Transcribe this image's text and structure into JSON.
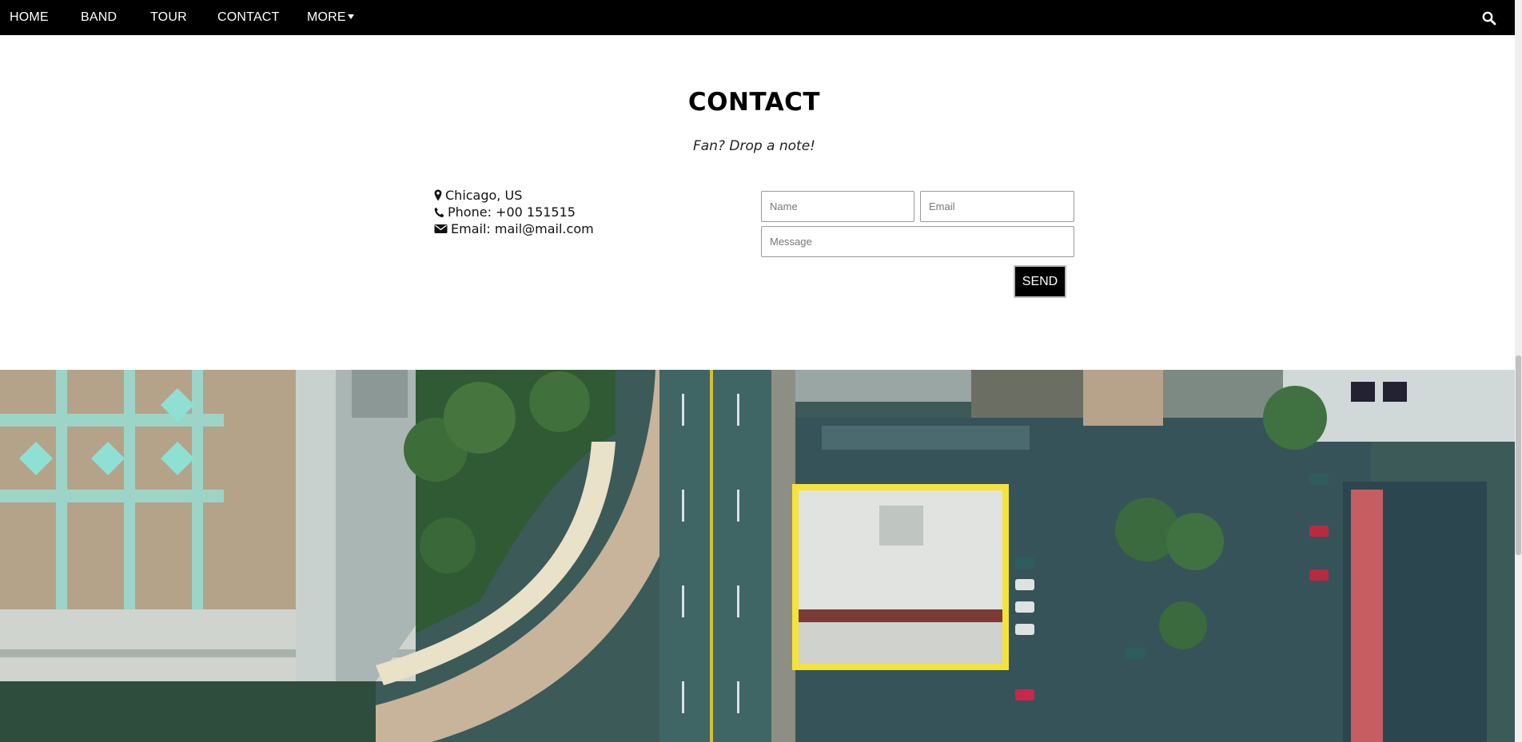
{
  "nav": {
    "items": [
      {
        "label": "HOME"
      },
      {
        "label": "BAND"
      },
      {
        "label": "TOUR"
      },
      {
        "label": "CONTACT"
      },
      {
        "label": "MORE"
      }
    ],
    "search_icon": "search-icon",
    "more_icon": "caret-down-icon"
  },
  "contact": {
    "title": "CONTACT",
    "subtitle": "Fan? Drop a note!",
    "location": "Chicago, US",
    "phone": "Phone: +00 151515",
    "email": "Email: mail@mail.com",
    "location_icon": "map-marker-icon",
    "phone_icon": "phone-icon",
    "email_icon": "envelope-icon"
  },
  "form": {
    "name_placeholder": "Name",
    "email_placeholder": "Email",
    "message_placeholder": "Message",
    "send_label": "SEND"
  },
  "colors": {
    "nav_background": "#000000",
    "highlight_frame": "#f5e33a"
  }
}
